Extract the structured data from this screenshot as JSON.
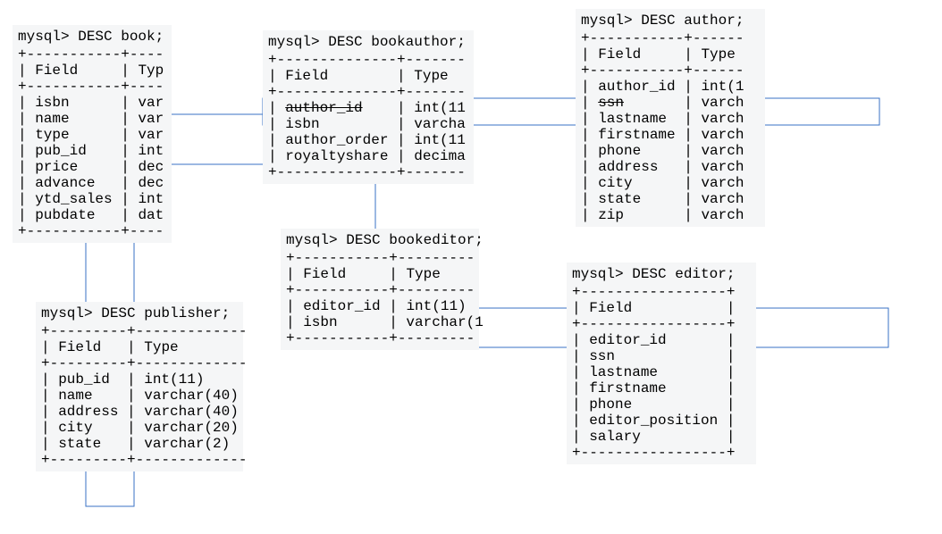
{
  "tables": {
    "book": {
      "prompt": "mysql> DESC book;",
      "header_field": "Field",
      "header_type": "Typ",
      "rows": [
        {
          "field": "isbn",
          "type": "var"
        },
        {
          "field": "name",
          "type": "var"
        },
        {
          "field": "type",
          "type": "var"
        },
        {
          "field": "pub_id",
          "type": "int"
        },
        {
          "field": "price",
          "type": "dec"
        },
        {
          "field": "advance",
          "type": "dec"
        },
        {
          "field": "ytd_sales",
          "type": "int"
        },
        {
          "field": "pubdate",
          "type": "dat"
        }
      ]
    },
    "bookauthor": {
      "prompt": "mysql> DESC bookauthor;",
      "header_field": "Field",
      "header_type": "Type",
      "rows": [
        {
          "field": "author_id",
          "type": "int(11"
        },
        {
          "field": "isbn",
          "type": "varcha"
        },
        {
          "field": "author_order",
          "type": "int(11"
        },
        {
          "field": "royaltyshare",
          "type": "decima"
        }
      ]
    },
    "author": {
      "prompt": "mysql> DESC author;",
      "header_field": "Field",
      "header_type": "Type",
      "rows": [
        {
          "field": "author_id",
          "type": "int(1"
        },
        {
          "field": "ssn",
          "type": "varch"
        },
        {
          "field": "lastname",
          "type": "varch"
        },
        {
          "field": "firstname",
          "type": "varch"
        },
        {
          "field": "phone",
          "type": "varch"
        },
        {
          "field": "address",
          "type": "varch"
        },
        {
          "field": "city",
          "type": "varch"
        },
        {
          "field": "state",
          "type": "varch"
        },
        {
          "field": "zip",
          "type": "varch"
        }
      ]
    },
    "bookeditor": {
      "prompt": "mysql> DESC bookeditor;",
      "header_field": "Field",
      "header_type": "Type",
      "rows": [
        {
          "field": "editor_id",
          "type": "int(11)"
        },
        {
          "field": "isbn",
          "type": "varchar(1"
        }
      ]
    },
    "publisher": {
      "prompt": "mysql> DESC publisher;",
      "header_field": "Field",
      "header_type": "Type",
      "rows": [
        {
          "field": "pub_id",
          "type": "int(11)"
        },
        {
          "field": "name",
          "type": "varchar(40)"
        },
        {
          "field": "address",
          "type": "varchar(40)"
        },
        {
          "field": "city",
          "type": "varchar(20)"
        },
        {
          "field": "state",
          "type": "varchar(2)"
        }
      ]
    },
    "editor": {
      "prompt": "mysql> DESC editor;",
      "header_field": "Field",
      "rows": [
        {
          "field": "editor_id"
        },
        {
          "field": "ssn"
        },
        {
          "field": "lastname"
        },
        {
          "field": "firstname"
        },
        {
          "field": "phone"
        },
        {
          "field": "editor_position"
        },
        {
          "field": "salary"
        }
      ]
    }
  }
}
